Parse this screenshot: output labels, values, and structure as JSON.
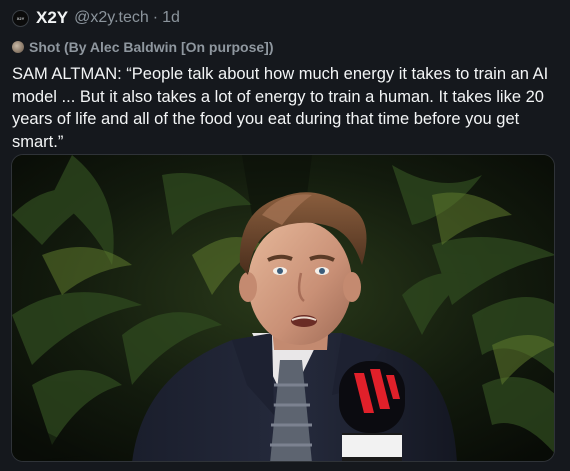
{
  "post": {
    "avatar_text": "X2Y",
    "display_name": "X2Y",
    "handle": "@x2y.tech",
    "separator": "·",
    "timestamp": "1d",
    "community": {
      "icon": "community-avatar-icon",
      "label": "Shot (By Alec Baldwin [On purpose])"
    },
    "text": "SAM ALTMAN: “People talk about how much energy it takes to train an AI model ... But it also takes a lot of energy to train a human. It takes like 20 years of life and all of the food you eat during that time before you get smart.”",
    "media": {
      "description_icon": "video-still",
      "mic_flag_text": "The Indian EXPRESS"
    }
  },
  "colors": {
    "background": "#15181d",
    "text_primary": "#f3f5f6",
    "text_secondary": "#8b949c",
    "mic_red": "#e0202a"
  }
}
